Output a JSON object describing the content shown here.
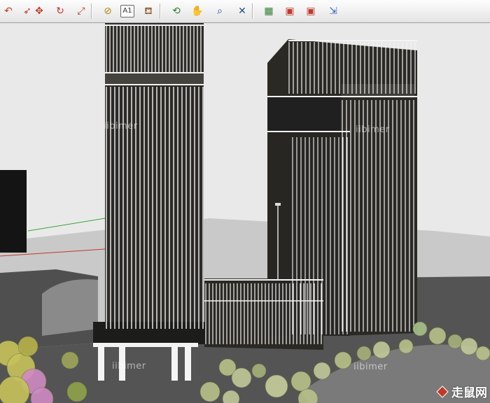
{
  "toolbar": {
    "tools": [
      {
        "name": "orbit-arrow-icon",
        "glyph": "↶",
        "color": "#c0392b"
      },
      {
        "name": "follow-me-icon",
        "glyph": "➶",
        "color": "#c0392b"
      },
      {
        "name": "move-icon",
        "glyph": "✥",
        "color": "#c0392b"
      },
      {
        "name": "rotate-icon",
        "glyph": "↻",
        "color": "#c0392b"
      },
      {
        "name": "scale-icon",
        "glyph": "⤢",
        "color": "#c0392b"
      },
      {
        "name": "tape-measure-icon",
        "glyph": "⊘",
        "color": "#b8860b"
      },
      {
        "name": "text-icon",
        "glyph": "A1",
        "color": "#333333"
      },
      {
        "name": "paint-bucket-icon",
        "glyph": "⛾",
        "color": "#8b5a2b"
      },
      {
        "name": "orbit-icon",
        "glyph": "⟲",
        "color": "#2e7d32"
      },
      {
        "name": "pan-hand-icon",
        "glyph": "✋",
        "color": "#555555"
      },
      {
        "name": "zoom-icon",
        "glyph": "⌕",
        "color": "#1f4e9a"
      },
      {
        "name": "zoom-extents-icon",
        "glyph": "✕",
        "color": "#1f4e9a"
      },
      {
        "name": "map-icon",
        "glyph": "▦",
        "color": "#2e7d32"
      },
      {
        "name": "warehouse-get-icon",
        "glyph": "▣",
        "color": "#c0392b"
      },
      {
        "name": "warehouse-share-icon",
        "glyph": "▣",
        "color": "#c0392b"
      },
      {
        "name": "export-icon",
        "glyph": "⇲",
        "color": "#3a66c4"
      }
    ]
  },
  "text_icon_label": "A1",
  "watermarks": [
    "iibimer",
    "iibimer",
    "iibimer",
    "iibimer"
  ],
  "logo": {
    "text": "走鼠网",
    "url": "www.zhulong.com"
  },
  "colors": {
    "sky": "#e8e8e8",
    "ground": "#5e5e5e",
    "building": "#2b2a26",
    "mullion": "#ffffff",
    "axis_green": "#3aa33a",
    "axis_red": "#c0392b"
  }
}
